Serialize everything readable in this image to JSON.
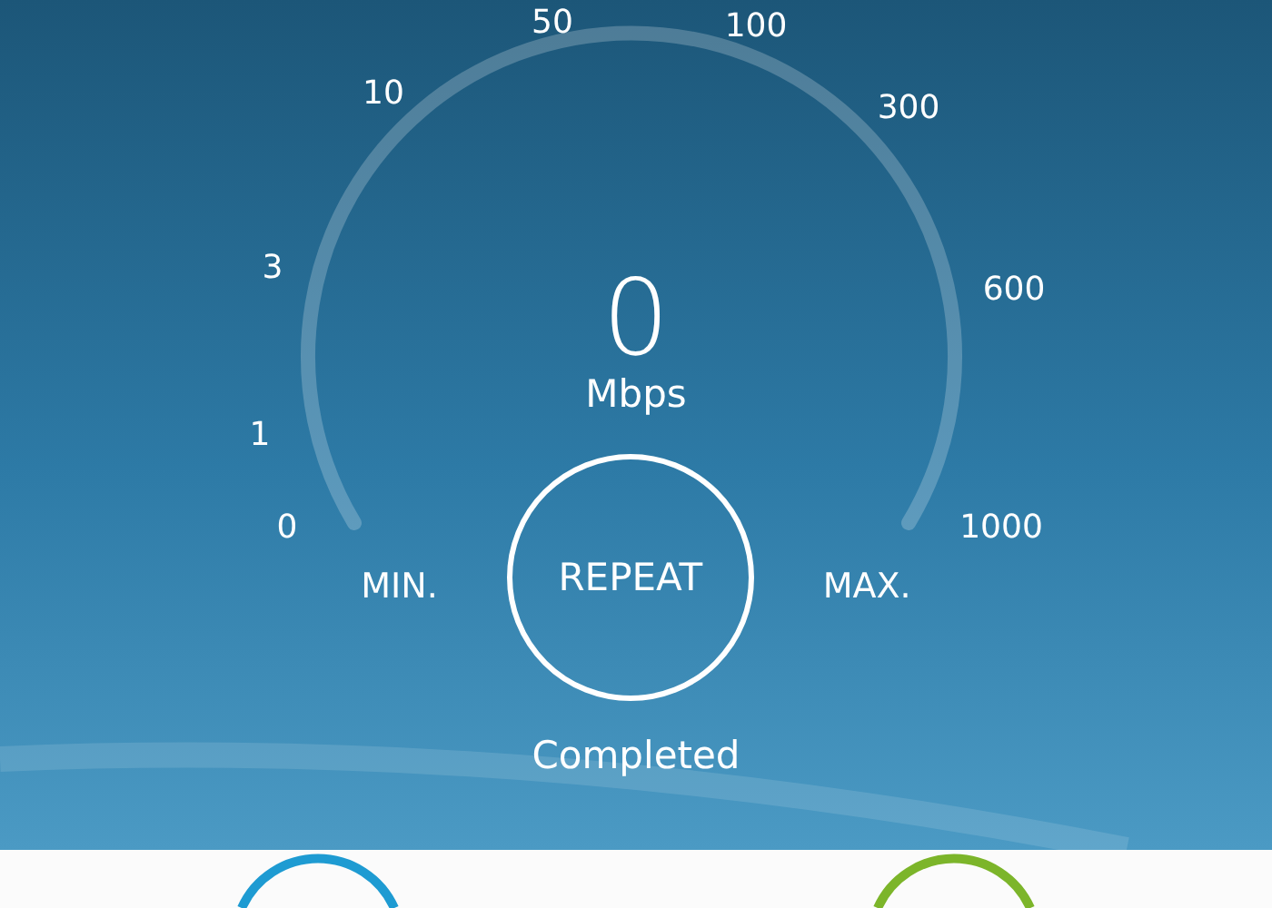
{
  "gauge": {
    "scale_labels": [
      "0",
      "1",
      "3",
      "10",
      "50",
      "100",
      "300",
      "600",
      "1000"
    ],
    "value": "0",
    "unit": "Mbps",
    "min_label": "MIN.",
    "max_label": "MAX."
  },
  "repeat_button": "REPEAT",
  "status": "Completed"
}
